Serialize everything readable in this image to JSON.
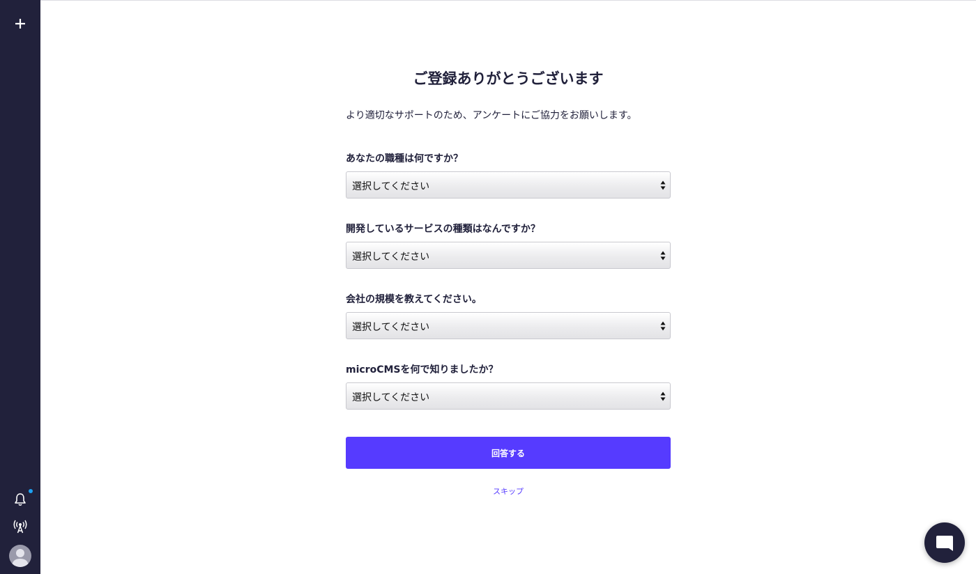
{
  "sidebar": {
    "add_icon": "plus-icon",
    "notification_icon": "bell-icon",
    "notification_dot_color": "#1da1f2",
    "broadcast_icon": "broadcast-icon",
    "avatar_icon": "user-avatar-icon"
  },
  "survey": {
    "title": "ご登録ありがとうございます",
    "lead": "より適切なサポートのため、アンケートにご協力をお願いします。",
    "questions": [
      {
        "label": "あなたの職種は何ですか？",
        "selected": "選択してください"
      },
      {
        "label": "開発しているサービスの種類はなんですか？",
        "selected": "選択してください"
      },
      {
        "label": "会社の規模を教えてください。",
        "selected": "選択してください"
      },
      {
        "label": "microCMSを何で知りましたか？",
        "selected": "選択してください"
      }
    ],
    "submit_label": "回答する",
    "skip_label": "スキップ"
  },
  "chat": {
    "icon": "chat-bubble-icon"
  },
  "colors": {
    "sidebar_bg": "#21213b",
    "accent": "#563bff",
    "text": "#21213b"
  }
}
